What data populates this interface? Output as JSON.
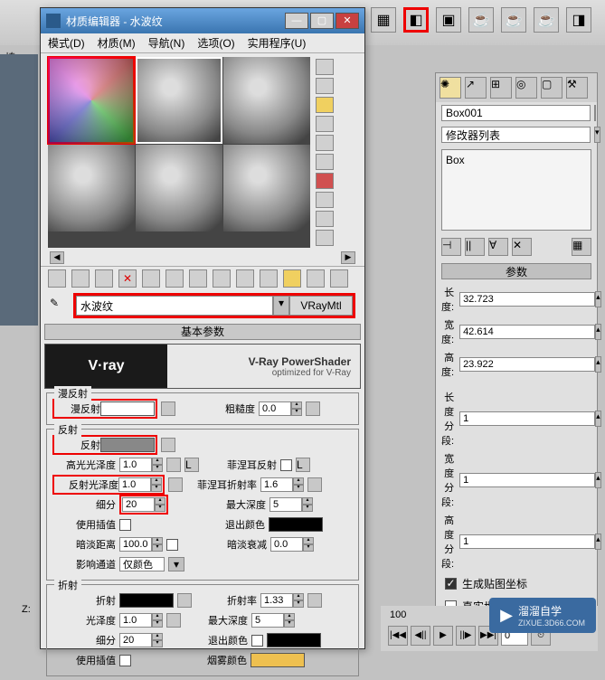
{
  "window": {
    "title": "材质编辑器 - 水波纹",
    "menus": [
      "模式(D)",
      "材质(M)",
      "导航(N)",
      "选项(O)",
      "实用程序(U)"
    ]
  },
  "material": {
    "name": "水波纹",
    "type": "VRayMtl"
  },
  "vray": {
    "logo": "V·ray",
    "title": "V-Ray PowerShader",
    "subtitle": "optimized for V-Ray"
  },
  "panels": {
    "basic": "基本参数"
  },
  "diffuse": {
    "section": "漫反射",
    "label": "漫反射",
    "roughness_label": "粗糙度",
    "roughness": "0.0"
  },
  "reflect": {
    "section": "反射",
    "label": "反射",
    "hilight_label": "高光光泽度",
    "hilight": "1.0",
    "refl_gloss_label": "反射光泽度",
    "refl_gloss": "1.0",
    "subdiv_label": "细分",
    "subdiv": "20",
    "use_interp_label": "使用插值",
    "dim_dist_label": "暗淡距离",
    "dim_dist": "100.0",
    "affect_label": "影响通道",
    "affect": "仅颜色",
    "fresnel_label": "菲涅耳反射",
    "fresnel_ior_label": "菲涅耳折射率",
    "fresnel_ior": "1.6",
    "max_depth_label": "最大深度",
    "max_depth": "5",
    "exit_color_label": "退出颜色",
    "dim_falloff_label": "暗淡衰减",
    "dim_falloff": "0.0"
  },
  "refract": {
    "section": "折射",
    "label": "折射",
    "gloss_label": "光泽度",
    "gloss": "1.0",
    "subdiv_label": "细分",
    "subdiv": "20",
    "use_interp_label": "使用插值",
    "ior_label": "折射率",
    "ior": "1.33",
    "max_depth_label": "最大深度",
    "max_depth": "5",
    "exit_color_label": "退出颜色",
    "fog_label": "烟雾颜色"
  },
  "right": {
    "object": "Box001",
    "modifier_label": "修改器列表",
    "stack_item": "Box",
    "params": "参数",
    "length_label": "长度:",
    "length": "32.723",
    "width_label": "宽度:",
    "width": "42.614",
    "height_label": "高度:",
    "height": "23.922",
    "lseg_label": "长度分段:",
    "lseg": "1",
    "wseg_label": "宽度分段:",
    "wseg": "1",
    "hseg_label": "高度分段:",
    "hseg": "1",
    "gen_uv": "生成贴图坐标",
    "real_world": "真实世界贴图大小"
  },
  "timeline": {
    "frame": "100",
    "cur": "0"
  },
  "watermark": {
    "text": "溜溜自学",
    "sub": "ZIXUE.3D66.COM"
  },
  "misc": {
    "fill": "填",
    "z": "Z:"
  }
}
